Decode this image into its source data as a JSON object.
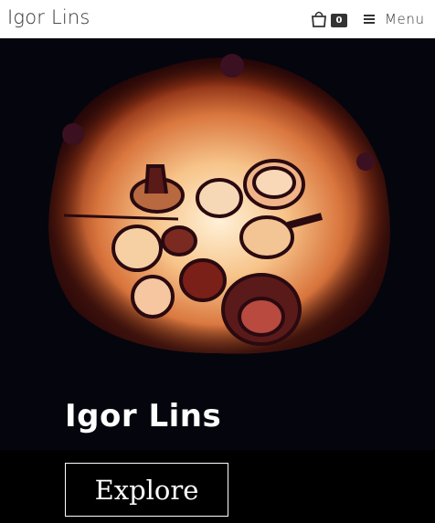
{
  "header": {
    "site_title": "Igor Lins",
    "cart_count": "0",
    "cart_icon": "shopping-bag-icon",
    "menu_icon": "hamburger-icon",
    "menu_label": "Menu"
  },
  "hero": {
    "image_subject": "kiln-with-glowing-pottery",
    "title": "Igor Lins",
    "cta_label": "Explore"
  },
  "colors": {
    "header_bg": "#ffffff",
    "header_text": "#333333",
    "hero_bg": "#05050d",
    "kiln_glow": "#f2b070",
    "button_border": "#ffffff"
  }
}
